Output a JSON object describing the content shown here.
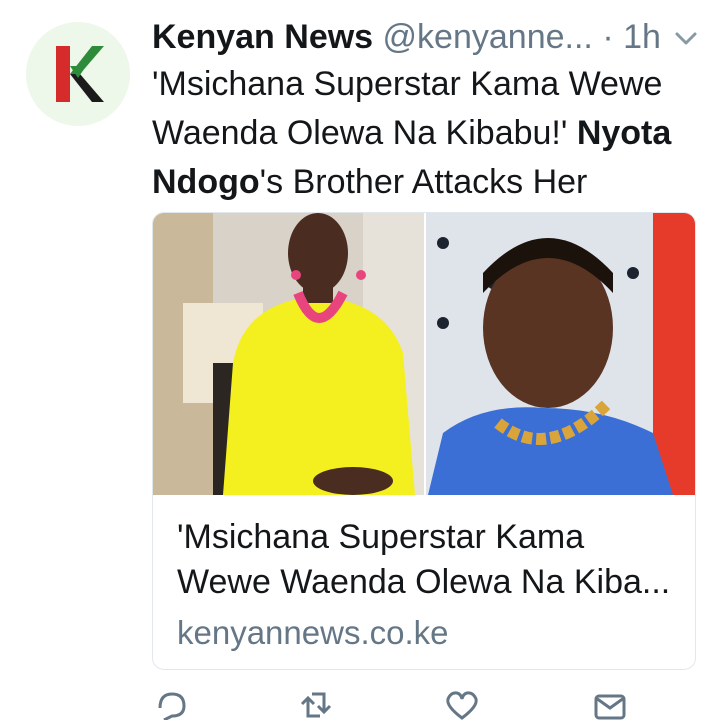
{
  "account": {
    "name": "Kenyan News",
    "handle": "@kenyanne...",
    "separator": "·",
    "time": "1h",
    "avatar_letter": "K",
    "avatar_icon": "kenyan-news-logo-icon"
  },
  "tweet": {
    "text_part1": "'Msichana Superstar Kama Wewe Waenda Olewa Na Kibabu!' ",
    "text_bold": "Nyota Ndogo",
    "text_part2": "'s Brother Attacks Her"
  },
  "card": {
    "title_line1": "'Msichana Superstar Kama",
    "title_line2": "Wewe Waenda Olewa Na Kiba...",
    "domain": "kenyannews.co.ke"
  },
  "actions": {
    "icons": [
      "reply-icon",
      "retweet-icon",
      "like-icon",
      "share-icon"
    ]
  },
  "colors": {
    "text": "#14171a",
    "muted": "#657786",
    "border": "#e1e8ed",
    "logo_red": "#d62b2b",
    "logo_green": "#2e8b3a",
    "avatar_bg": "#edf7ea"
  }
}
